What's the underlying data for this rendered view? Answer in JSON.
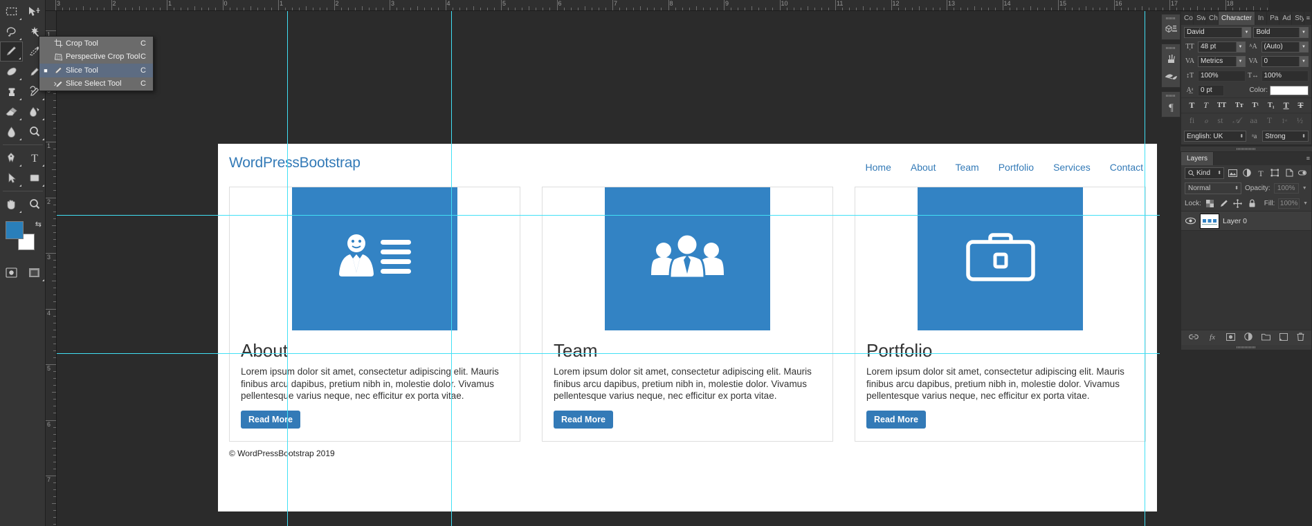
{
  "app": {
    "name": "Adobe Photoshop",
    "theme_bg": "#2b2b2b",
    "accent": "#337ab7",
    "guide_color": "#41e0f5"
  },
  "toolbar": {
    "tools": [
      {
        "name": "marquee-tool",
        "key": "M"
      },
      {
        "name": "move-tool",
        "key": "V"
      },
      {
        "name": "lasso-tool",
        "key": "L"
      },
      {
        "name": "magic-wand-tool",
        "key": "W"
      },
      {
        "name": "crop-slice-tool",
        "key": "C",
        "active": true
      },
      {
        "name": "eyedropper-tool",
        "key": "I"
      },
      {
        "name": "healing-brush-tool",
        "key": "J"
      },
      {
        "name": "brush-tool",
        "key": "B"
      },
      {
        "name": "clone-stamp-tool",
        "key": "S"
      },
      {
        "name": "history-brush-tool",
        "key": "Y"
      },
      {
        "name": "eraser-tool",
        "key": "E"
      },
      {
        "name": "gradient-tool",
        "key": "G"
      },
      {
        "name": "blur-tool",
        "key": "R"
      },
      {
        "name": "dodge-tool",
        "key": "O"
      },
      {
        "name": "pen-tool",
        "key": "P"
      },
      {
        "name": "type-tool",
        "key": "T"
      },
      {
        "name": "path-selection-tool",
        "key": "A"
      },
      {
        "name": "rectangle-tool",
        "key": "U"
      },
      {
        "name": "hand-tool",
        "key": "H"
      },
      {
        "name": "zoom-tool",
        "key": "Z"
      }
    ],
    "foreground_color": "#2a7fba",
    "background_color": "#ffffff",
    "swap_icon": "swap-colors-icon"
  },
  "flyout_menu": {
    "items": [
      {
        "label": "Crop Tool",
        "key": "C",
        "icon": "crop-icon",
        "selected": false
      },
      {
        "label": "Perspective Crop Tool",
        "key": "C",
        "icon": "perspective-crop-icon",
        "selected": false
      },
      {
        "label": "Slice Tool",
        "key": "C",
        "icon": "slice-icon",
        "selected": true
      },
      {
        "label": "Slice Select Tool",
        "key": "C",
        "icon": "slice-select-icon",
        "selected": false
      }
    ]
  },
  "rulers": {
    "horizontal": [
      "3",
      "2",
      "1",
      "0",
      "1",
      "2",
      "3",
      "4",
      "5",
      "6",
      "7",
      "8",
      "9",
      "10",
      "11",
      "12",
      "13",
      "14",
      "15",
      "16",
      "17",
      "18"
    ],
    "vertical": [
      "1",
      "0",
      "1",
      "2",
      "3",
      "4",
      "5",
      "6",
      "7"
    ],
    "unit": "inches"
  },
  "webpage": {
    "brand": "WordPressBootstrap",
    "nav": [
      "Home",
      "About",
      "Team",
      "Portfolio",
      "Services",
      "Contact"
    ],
    "cards": [
      {
        "title": "About",
        "icon": "id-card-person-icon",
        "text": "Lorem ipsum dolor sit amet, consectetur adipiscing elit. Mauris finibus arcu dapibus, pretium nibh in, molestie dolor. Vivamus pellentesque varius neque, nec efficitur ex porta vitae.",
        "button": "Read More"
      },
      {
        "title": "Team",
        "icon": "people-group-icon",
        "text": "Lorem ipsum dolor sit amet, consectetur adipiscing elit. Mauris finibus arcu dapibus, pretium nibh in, molestie dolor. Vivamus pellentesque varius neque, nec efficitur ex porta vitae.",
        "button": "Read More"
      },
      {
        "title": "Portfolio",
        "icon": "briefcase-icon",
        "text": "Lorem ipsum dolor sit amet, consectetur adipiscing elit. Mauris finibus arcu dapibus, pretium nibh in, molestie dolor. Vivamus pellentesque varius neque, nec efficitur ex porta vitae.",
        "button": "Read More"
      }
    ],
    "footer": "© WordPressBootstrap 2019",
    "thumb_color": "#3383c4"
  },
  "dock_icons": [
    {
      "name": "3d-panel-icon"
    },
    {
      "name": "brushes-panel-icon"
    },
    {
      "name": "brush-settings-panel-icon"
    },
    {
      "name": "paragraph-panel-icon"
    }
  ],
  "character_panel": {
    "tabs": [
      "Co",
      "Sw",
      "Ch",
      "Character",
      "In",
      "Pa",
      "Ad",
      "Sty"
    ],
    "active_tab": "Character",
    "font_family": "David",
    "font_style": "Bold",
    "font_size": "48 pt",
    "leading": "(Auto)",
    "kerning": "Metrics",
    "tracking": "0",
    "vertical_scale": "100%",
    "horizontal_scale": "100%",
    "baseline_shift": "0 pt",
    "color_label": "Color:",
    "color_value": "#ffffff",
    "style_glyphs": [
      "T",
      "T",
      "TT",
      "Tт",
      "T¹",
      "T₁",
      "T",
      "T"
    ],
    "open_type_glyphs": [
      "fi",
      "ℴ",
      "st",
      "𝒜",
      "aa",
      "T",
      "1ˢᵗ",
      "½"
    ],
    "language": "English: UK",
    "anti_alias_icon": "anti-alias-icon",
    "anti_alias": "Strong"
  },
  "layers_panel": {
    "tab": "Layers",
    "filter_label": "Kind",
    "filter_icons": [
      "pixel-filter-icon",
      "adjustment-filter-icon",
      "type-filter-icon",
      "shape-filter-icon",
      "smart-object-filter-icon"
    ],
    "blend_mode": "Normal",
    "opacity_label": "Opacity:",
    "opacity_value": "100%",
    "lock_label": "Lock:",
    "lock_icons": [
      "lock-transparent-pixels-icon",
      "lock-image-pixels-icon",
      "lock-position-icon",
      "lock-all-icon"
    ],
    "fill_label": "Fill:",
    "fill_value": "100%",
    "layers": [
      {
        "name": "Layer 0",
        "visible": true,
        "thumb": "layer-thumbnail"
      }
    ],
    "footer_icons": [
      "link-layers-icon",
      "layer-style-fx-icon",
      "layer-mask-icon",
      "adjustment-layer-icon",
      "new-group-icon",
      "new-layer-icon",
      "delete-layer-icon"
    ]
  }
}
